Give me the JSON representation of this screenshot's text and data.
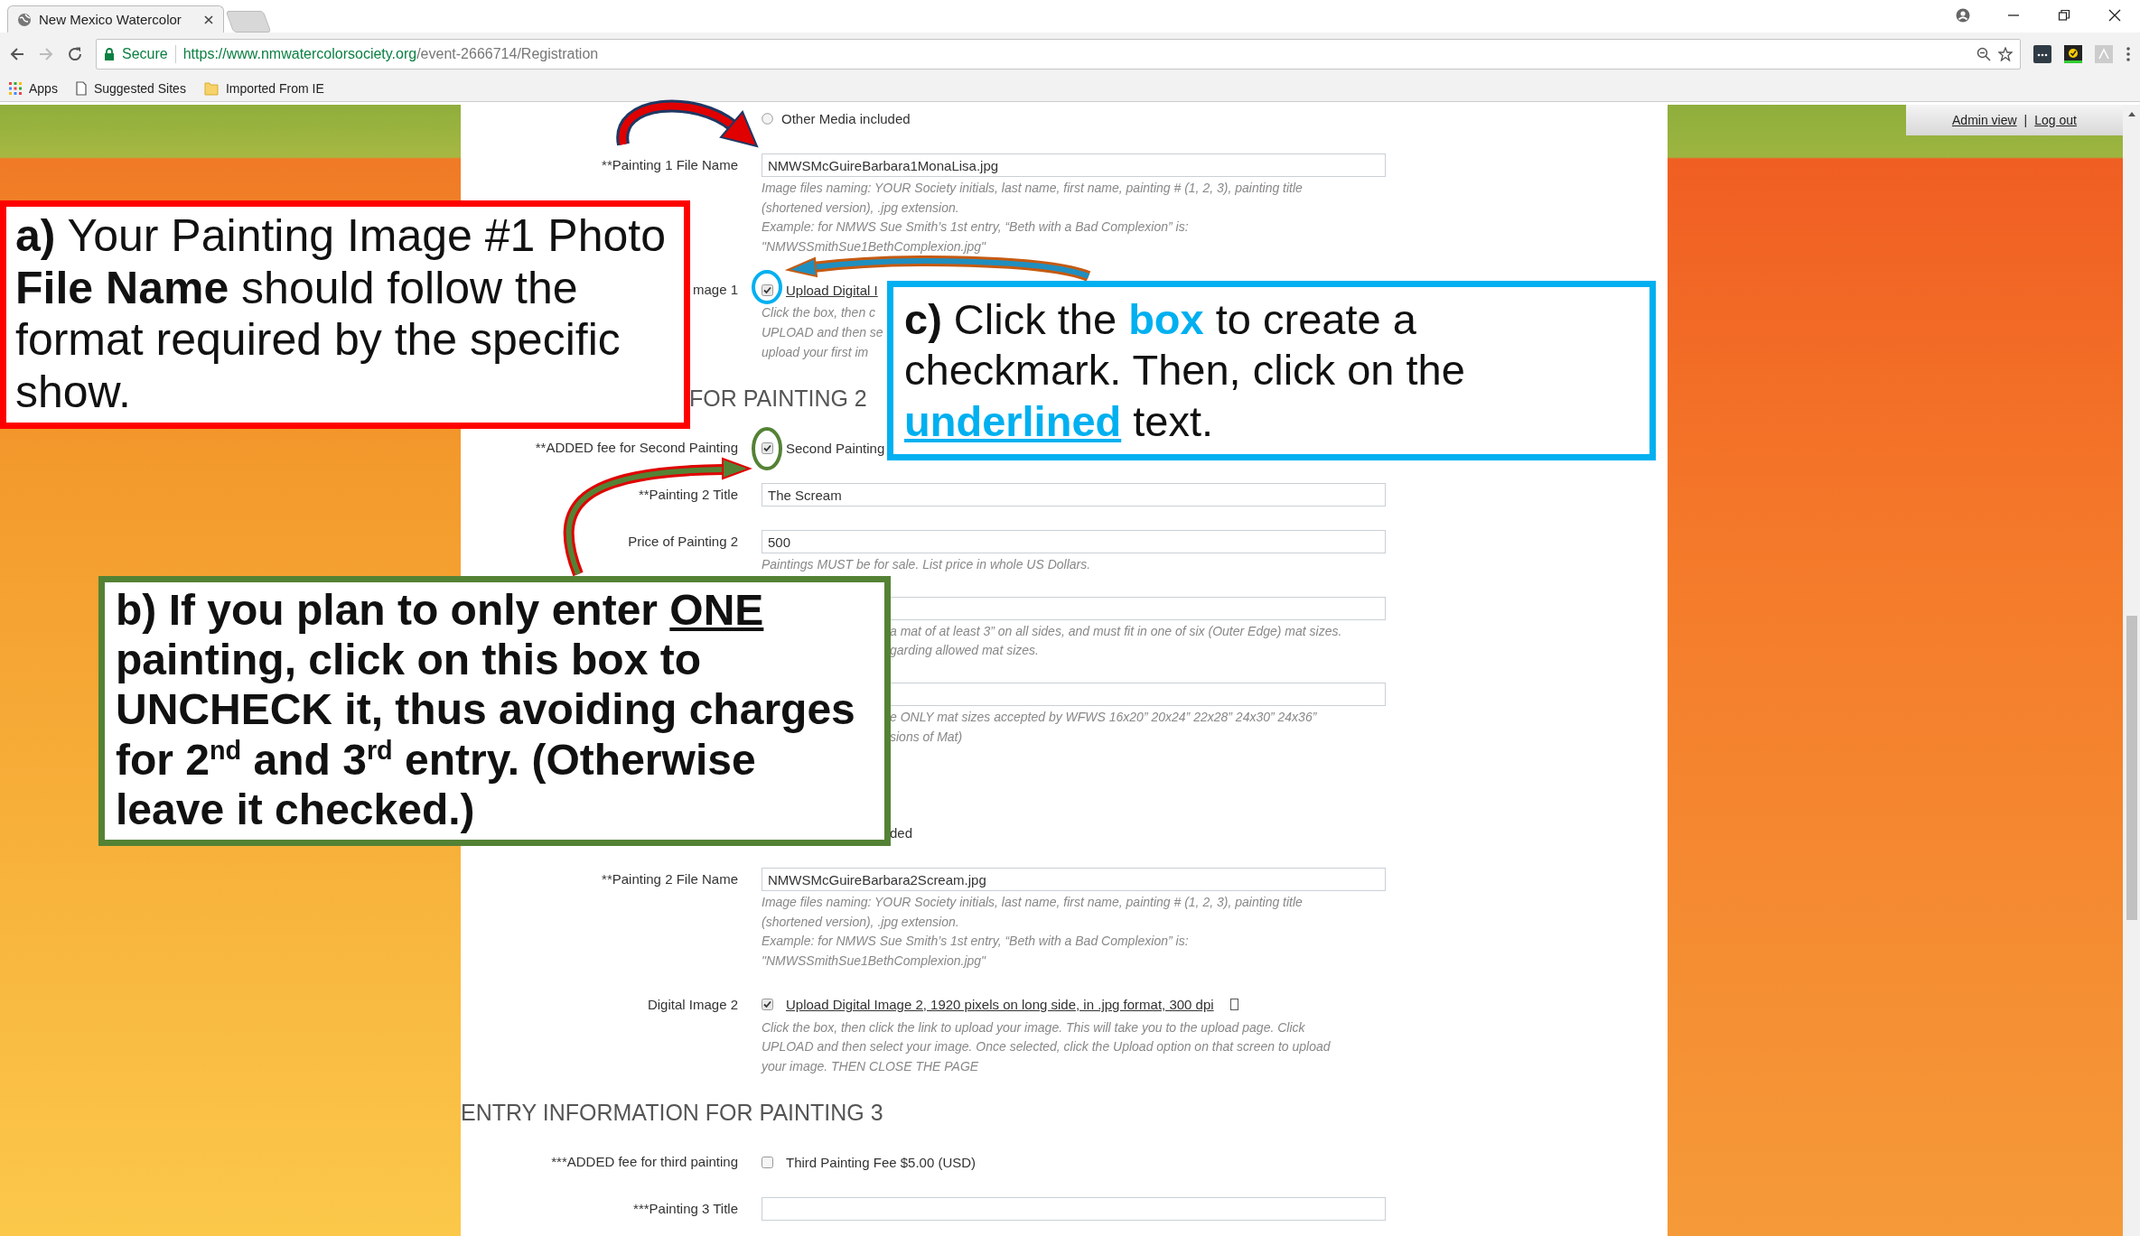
{
  "browser": {
    "tab_title": "New Mexico Watercolor",
    "secure_label": "Secure",
    "url_host": "https://www.nmwatercolorsociety.org",
    "url_path": "/event-2666714/Registration",
    "bookmarks": [
      {
        "kind": "apps",
        "label": "Apps"
      },
      {
        "kind": "page",
        "label": "Suggested Sites"
      },
      {
        "kind": "folder",
        "label": "Imported From IE"
      }
    ]
  },
  "admin_links": [
    "Admin view",
    "Log out"
  ],
  "admin_separator": "|",
  "form": {
    "rows": [
      {
        "kind": "radio",
        "option": "Other Media included",
        "selected": false
      },
      {
        "kind": "input",
        "label": "**Painting 1 File Name",
        "value": "NMWSMcGuireBarbara1MonaLisa.jpg",
        "help": [
          "Image files naming: YOUR Society initials, last name, first name, painting # (1, 2, 3), painting title",
          "(shortened version), .jpg extension.",
          "Example: for NMWS Sue Smith’s 1st entry, “Beth with a Bad Complexion” is:",
          "\"NMWSSmithSue1BethComplexion.jpg\""
        ]
      },
      {
        "kind": "checkbox",
        "label": "mage 1",
        "checked": true,
        "link": "Upload Digital I",
        "help": [
          "Click the box, then c",
          "UPLOAD and then se",
          "upload your first im"
        ]
      },
      {
        "kind": "heading",
        "text": "FOR PAINTING 2",
        "covered": true
      },
      {
        "kind": "checkbox",
        "label": "**ADDED fee for Second Painting",
        "checked": true,
        "option": "Second Painting"
      },
      {
        "kind": "input",
        "label": "**Painting 2 Title",
        "value": "The Scream"
      },
      {
        "kind": "input",
        "label": "Price of Painting 2",
        "value": "500",
        "help": [
          "Paintings MUST be for sale. List price in whole US Dollars."
        ]
      },
      {
        "kind": "input",
        "covered": true,
        "help": [
          "a mat of at least 3” on all sides, and must fit in one of six (Outer Edge) mat sizes.",
          "garding allowed mat sizes."
        ]
      },
      {
        "kind": "input",
        "covered": true,
        "help": [
          "e ONLY mat sizes accepted by WFWS 16x20” 20x24” 22x28” 24x30” 24x36”",
          "sions of Mat)"
        ]
      },
      {
        "kind": "covered_text",
        "text": "ded"
      },
      {
        "kind": "input",
        "label": "**Painting 2 File Name",
        "value": "NMWSMcGuireBarbara2Scream.jpg",
        "help": [
          "Image files naming: YOUR Society initials, last name, first name, painting # (1, 2, 3), painting title",
          "(shortened version), .jpg extension.",
          "Example: for NMWS Sue Smith’s 1st entry, “Beth with a Bad Complexion” is:",
          "\"NMWSSmithSue1BethComplexion.jpg\""
        ]
      },
      {
        "kind": "checkbox",
        "label": "Digital Image 2",
        "checked": true,
        "link": "Upload Digital Image 2, 1920 pixels on long side, in .jpg format, 300 dpi",
        "help": [
          "Click the box, then click the link to upload your image. This will take you to the upload page. Click",
          "UPLOAD and then select your image. Once selected, click the Upload option on that screen to upload",
          "your image. THEN CLOSE THE PAGE"
        ]
      },
      {
        "kind": "heading",
        "text": "ENTRY INFORMATION FOR PAINTING 3"
      },
      {
        "kind": "checkbox",
        "label": "***ADDED fee for third painting",
        "checked": false,
        "option": "Third Painting Fee $5.00 (USD)"
      },
      {
        "kind": "input",
        "label": "***Painting 3 Title",
        "value": ""
      }
    ]
  },
  "callouts": [
    {
      "color": "#ff0000",
      "segments": [
        {
          "text": "a)",
          "kind": "strong"
        },
        {
          "text": " Your Painting Image #1 Photo ",
          "kind": "plain"
        },
        {
          "text": "File Name",
          "kind": "strong"
        },
        {
          "text": " should follow the format required by the specific show.",
          "kind": "plain"
        }
      ]
    },
    {
      "color": "#00b0f0",
      "segments": [
        {
          "text": "c)",
          "kind": "strong"
        },
        {
          "text": " Click the ",
          "kind": "plain"
        },
        {
          "text": "box",
          "kind": "accent"
        },
        {
          "text": " to create a checkmark. Then, click on the ",
          "kind": "plain"
        },
        {
          "text": "underlined",
          "kind": "accent_link"
        },
        {
          "text": " text.",
          "kind": "plain"
        }
      ]
    },
    {
      "color": "#548235",
      "segments": [
        {
          "text": "b) If you plan to only enter ",
          "kind": "strong"
        },
        {
          "text": "ONE",
          "kind": "strong_link"
        },
        {
          "text": " painting, click on this box to UNCHECK it, thus avoiding charges for 2",
          "kind": "strong"
        },
        {
          "text": "nd",
          "kind": "superscript"
        },
        {
          "text": " and 3",
          "kind": "strong"
        },
        {
          "text": "rd",
          "kind": "superscript"
        },
        {
          "text": " entry. (Otherwise leave it checked.)",
          "kind": "strong"
        }
      ]
    }
  ],
  "circles": [
    {
      "color": "#00b0f0"
    },
    {
      "color": "#548235"
    }
  ]
}
